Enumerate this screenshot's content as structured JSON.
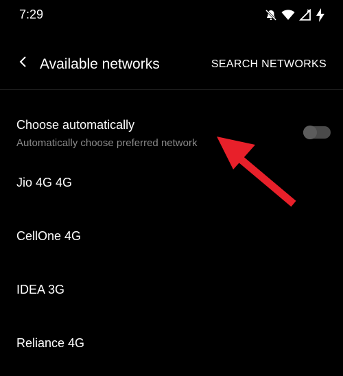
{
  "status_bar": {
    "time": "7:29",
    "icons": [
      "bell-muted-icon",
      "wifi-icon",
      "cellular-signal-icon",
      "battery-charging-icon"
    ]
  },
  "app_bar": {
    "title": "Available networks",
    "back_icon": "chevron-left-icon",
    "action_label": "SEARCH NETWORKS"
  },
  "auto_select": {
    "label": "Choose automatically",
    "subtitle": "Automatically choose preferred network",
    "enabled": false
  },
  "networks": [
    {
      "label": "Jio 4G 4G"
    },
    {
      "label": "CellOne 4G"
    },
    {
      "label": "IDEA 3G"
    },
    {
      "label": "Reliance 4G"
    }
  ],
  "annotation": {
    "arrow_color": "#e8202a"
  },
  "colors": {
    "background": "#000000",
    "text_primary": "#ffffff",
    "text_secondary": "#8a8a8a"
  }
}
